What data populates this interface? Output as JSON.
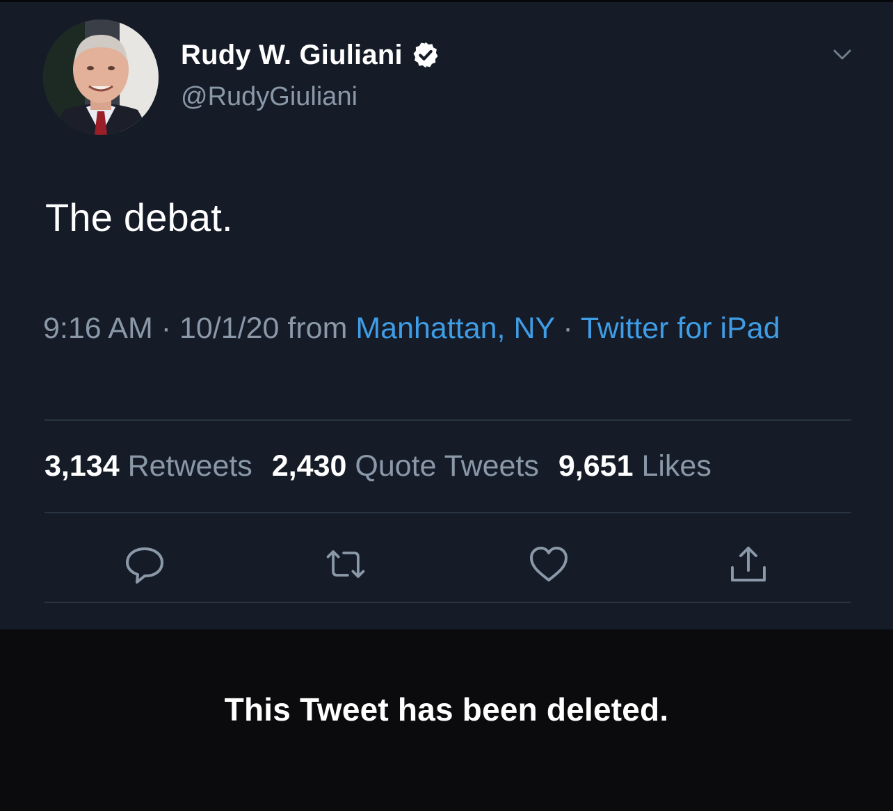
{
  "user": {
    "display_name": "Rudy W. Giuliani",
    "handle": "@RudyGiuliani",
    "verified": true,
    "verified_icon": "verified-badge-icon"
  },
  "tweet": {
    "text": "The debat.",
    "time": "9:16 AM",
    "separator1": " · ",
    "date": "10/1/20",
    "from_word": " from ",
    "location": "Manhattan, NY",
    "separator2": " · ",
    "source": "Twitter for iPad"
  },
  "stats": {
    "retweets_count": "3,134",
    "retweets_label": "Retweets",
    "quotes_count": "2,430",
    "quotes_label": "Quote Tweets",
    "likes_count": "9,651",
    "likes_label": "Likes"
  },
  "actions": {
    "reply_icon": "reply-icon",
    "retweet_icon": "retweet-icon",
    "like_icon": "heart-icon",
    "share_icon": "share-icon"
  },
  "notice": {
    "deleted_text": "This Tweet has been deleted."
  },
  "colors": {
    "background": "#151c28",
    "text": "#ffffff",
    "secondary": "#8a98a8",
    "link": "#3f9de6",
    "notice_bar": "#0b0b0d"
  }
}
